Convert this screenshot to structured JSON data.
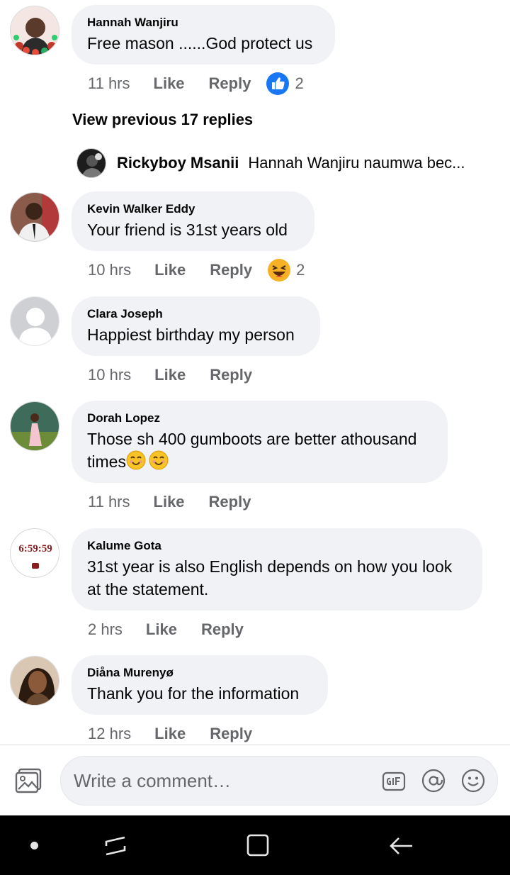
{
  "comments": [
    {
      "author": "Hannah Wanjiru",
      "text": "Free mason ......God protect us",
      "time": "11 hrs",
      "like": "Like",
      "reply": "Reply",
      "reaction": {
        "type": "like-icon",
        "count": "2"
      }
    },
    {
      "author": "Kevin Walker Eddy",
      "text": "Your friend is 31st years old",
      "time": "10 hrs",
      "like": "Like",
      "reply": "Reply",
      "reaction": {
        "type": "laughing-emoji-icon",
        "count": "2"
      }
    },
    {
      "author": "Clara Joseph",
      "text": "Happiest birthday my person",
      "time": "10 hrs",
      "like": "Like",
      "reply": "Reply"
    },
    {
      "author": "Dorah Lopez",
      "text_line1": "Those sh 400 gumboots are better athousand",
      "text_line2": "times",
      "time": "11 hrs",
      "like": "Like",
      "reply": "Reply"
    },
    {
      "author": "Kalume Gota",
      "text_line1": "31st year is also English depends on how you look",
      "text_line2": "at the statement.",
      "avatar_text": "6:59:59",
      "time": "2 hrs",
      "like": "Like",
      "reply": "Reply"
    },
    {
      "author": "Diåna Murenyø",
      "text": "Thank you for the information",
      "time": "12 hrs",
      "like": "Like",
      "reply": "Reply"
    }
  ],
  "view_previous": "View previous 17 replies",
  "reply_preview": {
    "author": "Rickyboy Msanii",
    "text": "Hannah Wanjiru naumwa bec..."
  },
  "composer": {
    "placeholder": "Write a comment…",
    "icons": [
      "photo-icon",
      "gif-icon",
      "at-icon",
      "smile-icon"
    ]
  },
  "nav": {
    "icons": [
      "dot-icon",
      "recent-apps-icon",
      "home-icon",
      "back-icon"
    ]
  },
  "colors": {
    "bubble": "#f0f2f5",
    "meta": "#65676b",
    "like_blue": "#1877f2",
    "navbar": "#000000"
  }
}
